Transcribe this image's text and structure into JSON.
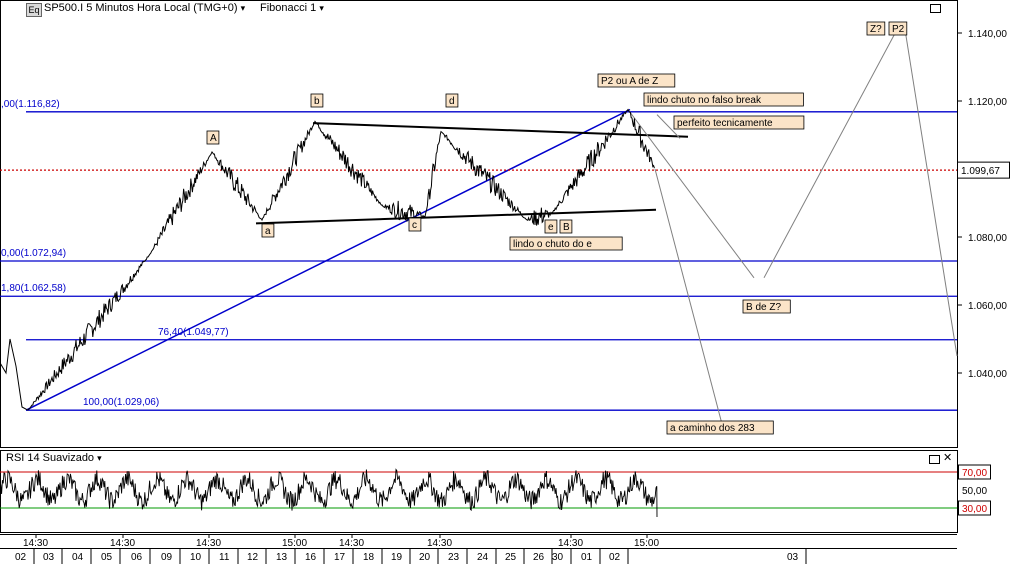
{
  "header": {
    "symbol_badge": "Eq",
    "instrument": "SP500.I 5 Minutos Hora Local (TMG+0)",
    "study": "Fibonacci 1",
    "dropdown_glyph": "▾"
  },
  "rsi_panel": {
    "title": "RSI 14 Suavizado",
    "dropdown_glyph": "▾"
  },
  "window_controls": {
    "minimize": "▭",
    "close": "✕"
  },
  "colors": {
    "price": "#000000",
    "fib": "#0000cc",
    "current_price": "#cc0000",
    "rsi_upper": "#cc0000",
    "rsi_lower": "#009900",
    "label_bg": "#fbe4c8",
    "projection": "#808080"
  },
  "chart_data": [
    {
      "type": "line",
      "name": "price",
      "y_ticks": [
        "1.140,00",
        "1.120,00",
        "1.100,00",
        "1.080,00",
        "1.060,00",
        "1.040,00"
      ],
      "ylim": [
        1025,
        1143
      ],
      "current_price": {
        "value": 1099.67,
        "label": "1.099,67"
      },
      "fib_levels": [
        {
          "value": 1116.82,
          "label": ",00(1.116,82)"
        },
        {
          "value": 1072.94,
          "label": "0,00(1.072,94)"
        },
        {
          "value": 1062.58,
          "label": "1,80(1.062,58)"
        },
        {
          "value": 1049.77,
          "label": "76,40(1.049,77)"
        },
        {
          "value": 1029.06,
          "label": "100,00(1.029,06)"
        }
      ],
      "x_time_ticks": [
        "14:30",
        "14:30",
        "14:30",
        "15:00",
        "14:30",
        "14:30",
        "14:30",
        "15:00"
      ],
      "x_date_ticks": [
        "02",
        "03",
        "04",
        "05",
        "06",
        "09",
        "10",
        "11",
        "12",
        "13",
        "16",
        "17",
        "18",
        "19",
        "20",
        "23",
        "24",
        "25",
        "26",
        "30",
        "01",
        "02",
        "03"
      ],
      "wave_labels": [
        "A",
        "b",
        "d",
        "a",
        "c",
        "e",
        "B",
        "P2 ou A de Z",
        "Z?",
        "P2"
      ],
      "annotations": [
        "lindo chuto no falso break",
        "perfeito tecnicamente",
        "lindo o chuto do e",
        "B de Z?",
        "a caminho dos 283"
      ],
      "key_points": [
        {
          "date": "02",
          "value": 1029.06
        },
        {
          "date": "09",
          "value": 1075.0
        },
        {
          "date": "10",
          "value": 1105.0
        },
        {
          "date": "13",
          "value": 1085.0
        },
        {
          "date": "16",
          "value": 1114.0
        },
        {
          "date": "19",
          "value": 1089.0
        },
        {
          "date": "20",
          "value": 1086.0
        },
        {
          "date": "23",
          "value": 1111.0
        },
        {
          "date": "26",
          "value": 1085.0
        },
        {
          "date": "30",
          "value": 1087.0
        },
        {
          "date": "02",
          "value": 1117.5
        },
        {
          "date": "02",
          "value": 1100.0
        }
      ]
    },
    {
      "type": "line",
      "name": "RSI 14 Suavizado",
      "y_ticks": [
        "70,00",
        "50,00",
        "30,00"
      ],
      "levels": [
        70,
        30
      ],
      "ylim": [
        15,
        85
      ],
      "last_value": 20
    }
  ]
}
